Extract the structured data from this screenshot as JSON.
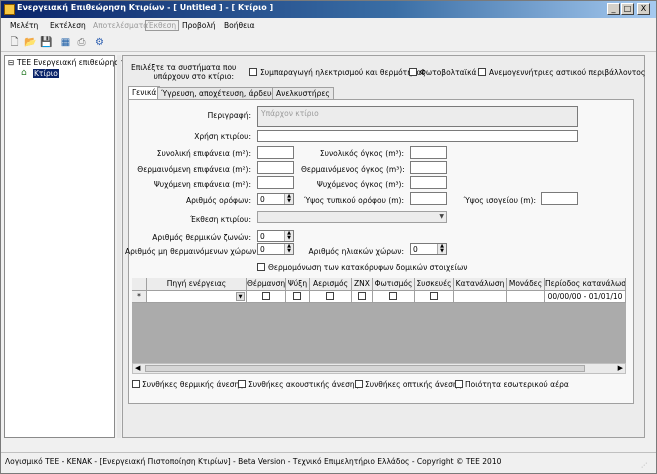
{
  "window": {
    "title": "Ενεργειακή Επιθεώρηση Κτιρίων - [ Untitled ] - [ Κτίριο ]",
    "minimize": "_",
    "restore": "□",
    "close": "X"
  },
  "menu": {
    "items": [
      "Μελέτη",
      "Εκτέλεση",
      "Αποτελέσματα",
      "Έκθεση",
      "Προβολή",
      "Βοήθεια"
    ]
  },
  "tree": {
    "root": "ΤΕΕ Ενεργειακή επιθεώρηση",
    "child": "Κτίριο"
  },
  "systems": {
    "prompt_line1": "Επιλέξτε τα συστήματα που",
    "prompt_line2": "υπάρχουν στο κτίριο:",
    "cogeneration": "Συμπαραγωγή ηλεκτρισμού και θερμότητας",
    "photovoltaic": "Φωτοβολταϊκά",
    "wind_turbines": "Ανεμογεννήτριες αστικού περιβάλλοντος"
  },
  "tabs": [
    "Γενικά",
    "Ύγρευση, αποχέτευση, άρδευση",
    "Ανελκυστήρες"
  ],
  "form": {
    "description_label": "Περιγραφή:",
    "description_value": "Υπάρχον κτίριο",
    "use_label": "Χρήση κτιρίου:",
    "total_area_label": "Συνολική επιφάνεια (m²):",
    "heated_area_label": "Θερμαινόμενη επιφάνεια (m²):",
    "cooled_area_label": "Ψυχόμενη επιφάνεια (m²):",
    "total_volume_label": "Συνολικός όγκος (m³):",
    "heated_volume_label": "Θερμαινόμενος όγκος (m³):",
    "cooled_volume_label": "Ψυχόμενος όγκος (m³):",
    "floors_label": "Αριθμός ορόφων:",
    "floors_value": "0",
    "floor_height_label": "Ύψος τυπικού ορόφου (m):",
    "ground_height_label": "Ύψος ισογείου (m):",
    "exposure_label": "Έκθεση κτιρίου:",
    "zones_label": "Αριθμός θερμικών ζωνών:",
    "zones_value": "0",
    "unheated_label": "Αριθμός μη θερμαινόμενων χώρων:",
    "unheated_value": "0",
    "solar_label": "Αριθμός ηλιακών χώρων:",
    "solar_value": "0",
    "insulation_label": "Θερμομόνωση των κατακόρυφων δομικών στοιχείων"
  },
  "grid": {
    "headers": [
      "Πηγή ενέργειας",
      "Θέρμανση",
      "Ψύξη",
      "Αερισμός",
      "ΖΝΧ",
      "Φωτισμός",
      "Συσκευές",
      "Κατανάλωση",
      "Μονάδες",
      "Περίοδος κατανάλωσης"
    ],
    "new_row_marker": "*",
    "period_value": "00/00/00 - 01/01/10"
  },
  "bottom_checks": [
    "Συνθήκες θερμικής άνεσης",
    "Συνθήκες ακουστικής άνεσης",
    "Συνθήκες οπτικής άνεσης",
    "Ποιότητα εσωτερικού αέρα"
  ],
  "status": {
    "text": "Λογισμικό ΤΕΕ - ΚΕΝΑΚ - [Ενεργειακή Πιστοποίηση Κτιρίων] - Beta Version - Τεχνικό Επιμελητήριο Ελλάδος - Copyright © TEE 2010"
  }
}
